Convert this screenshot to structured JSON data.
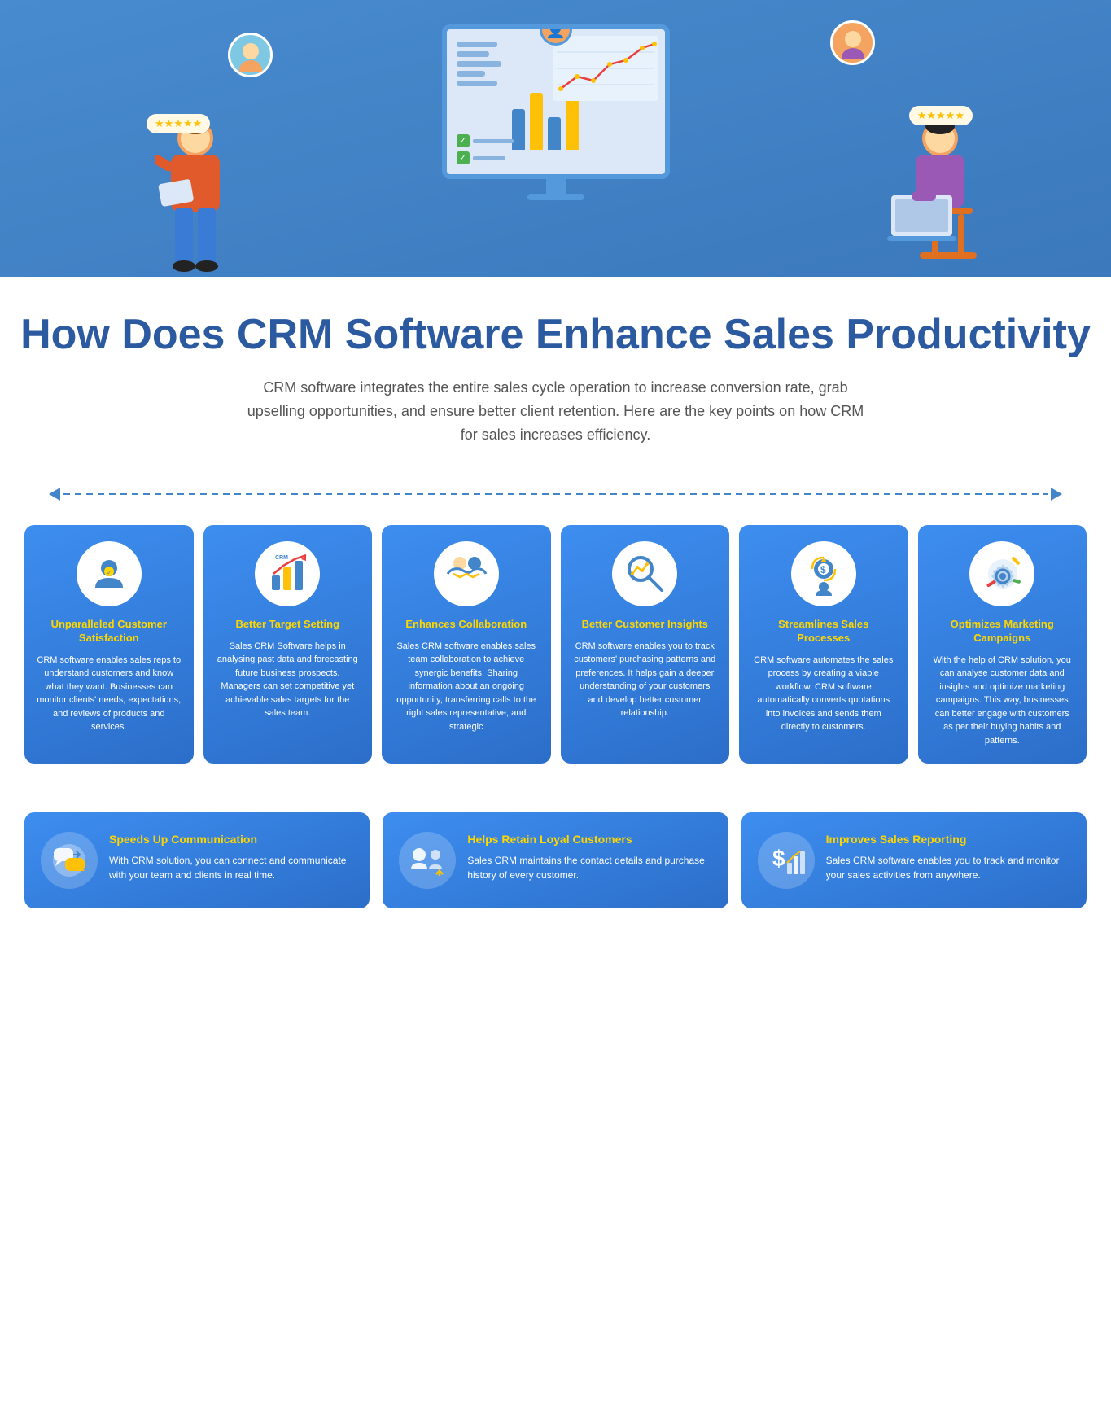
{
  "hero": {
    "alt": "CRM Software Hero Illustration"
  },
  "title": {
    "main": "How Does CRM Software Enhance Sales Productivity",
    "subtitle": "CRM software integrates the entire sales cycle operation to increase conversion rate, grab upselling opportunities, and ensure better client retention. Here are the key points on how CRM for sales increases efficiency."
  },
  "top_cards": [
    {
      "id": "unparalleled-customer-satisfaction",
      "title": "Unparalleled Customer Satisfaction",
      "icon": "🏆",
      "text": "CRM software enables sales reps to understand customers and know what they want. Businesses can monitor clients' needs, expectations, and reviews of products and services."
    },
    {
      "id": "better-target-setting",
      "title": "Better Target Setting",
      "icon": "📊",
      "text": "Sales CRM Software helps in analysing past data and forecasting future business prospects. Managers can set competitive yet achievable sales targets for the sales team."
    },
    {
      "id": "enhances-collaboration",
      "title": "Enhances Collaboration",
      "icon": "🤝",
      "text": "Sales CRM software enables sales team collaboration to achieve synergic benefits. Sharing information about an ongoing opportunity, transferring calls to the right sales representative, and strategic"
    },
    {
      "id": "better-customer-insights",
      "title": "Better Customer Insights",
      "icon": "🔍",
      "text": "CRM software enables you to track customers' purchasing patterns and preferences. It helps gain a deeper understanding of your customers and develop better customer relationship."
    },
    {
      "id": "streamlines-sales-processes",
      "title": "Streamlines Sales Processes",
      "icon": "⚙️",
      "text": "CRM software automates the sales process by creating a viable workflow. CRM software automatically converts quotations into invoices and sends them directly to customers."
    },
    {
      "id": "optimizes-marketing-campaigns",
      "title": "Optimizes Marketing Campaigns",
      "icon": "📢",
      "text": "With the help of CRM solution, you can analyse customer data and insights and optimize marketing campaigns. This way, businesses can better engage with customers as per their buying habits and patterns."
    }
  ],
  "bottom_cards": [
    {
      "id": "speeds-up-communication",
      "title": "Speeds Up Communication",
      "icon": "💬",
      "text": "With CRM solution, you can connect and communicate with your team and clients in real time."
    },
    {
      "id": "helps-retain-loyal-customers",
      "title": "Helps Retain Loyal Customers",
      "icon": "👥",
      "text": "Sales CRM maintains the contact details and purchase history of every customer."
    },
    {
      "id": "improves-sales-reporting",
      "title": "Improves Sales Reporting",
      "icon": "💲",
      "text": "Sales CRM software enables you to track and monitor your sales activities from anywhere."
    }
  ],
  "stars": "★★★★★"
}
